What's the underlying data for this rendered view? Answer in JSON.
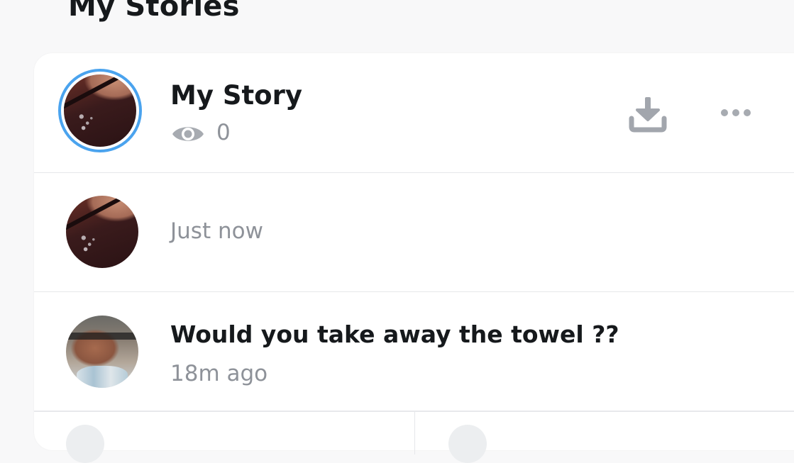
{
  "section": {
    "title": "My Stories"
  },
  "story": {
    "title": "My Story",
    "view_count": "0",
    "ring_color": "#4aa3ee",
    "icons": {
      "views": "eye-icon",
      "download": "download-icon",
      "more": "more-dots-icon"
    }
  },
  "snaps": [
    {
      "time": "Just now",
      "caption": ""
    },
    {
      "caption": "Would you take away the towel ??",
      "time": "18m ago"
    }
  ]
}
